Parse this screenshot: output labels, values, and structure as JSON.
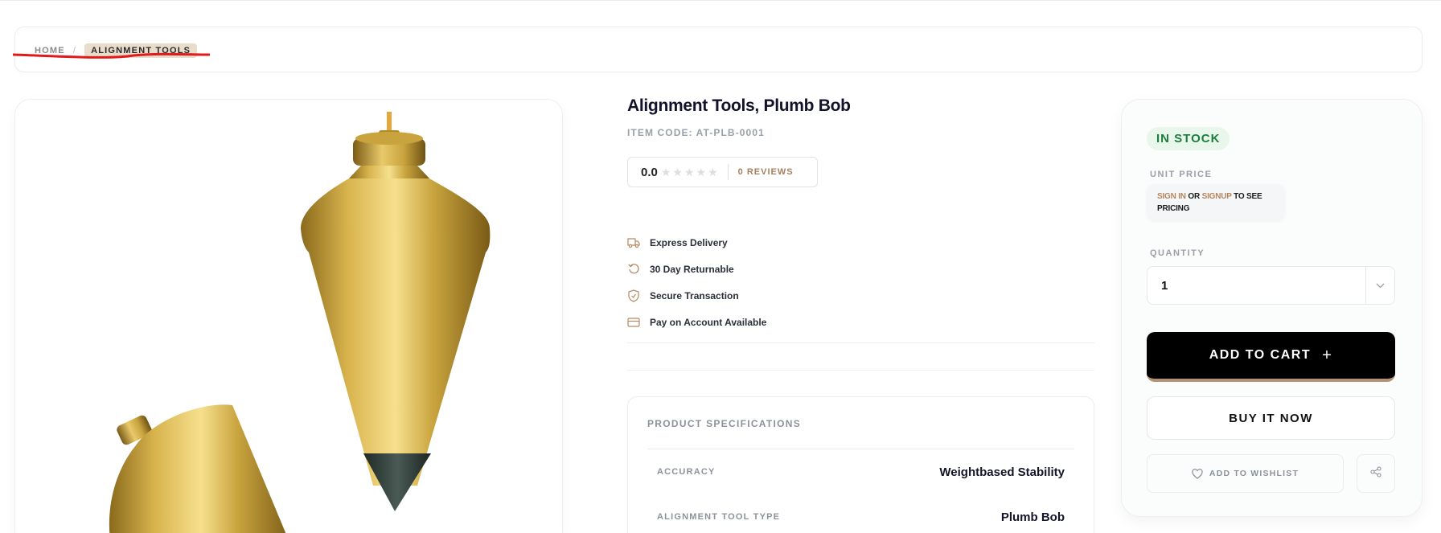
{
  "breadcrumb": {
    "home": "HOME",
    "separator": "/",
    "current": "ALIGNMENT TOOLS"
  },
  "product": {
    "title": "Alignment Tools, Plumb Bob",
    "item_code": "ITEM CODE: AT-PLB-0001",
    "rating_value": "0.0",
    "stars_filled": 0,
    "stars_total": 5,
    "reviews": "0 REVIEWS",
    "image_icon": "plumb-bob-photo"
  },
  "features": [
    {
      "icon": "truck-icon",
      "label": "Express Delivery"
    },
    {
      "icon": "return-icon",
      "label": "30 Day Returnable"
    },
    {
      "icon": "shield-check-icon",
      "label": "Secure Transaction"
    },
    {
      "icon": "credit-card-icon",
      "label": "Pay on Account Available"
    }
  ],
  "specs": {
    "title": "PRODUCT SPECIFICATIONS",
    "rows": [
      {
        "key": "ACCURACY",
        "value": "Weightbased Stability"
      },
      {
        "key": "ALIGNMENT TOOL TYPE",
        "value": "Plumb Bob"
      }
    ]
  },
  "buy_box": {
    "stock": "IN STOCK",
    "unit_price_label": "UNIT PRICE",
    "sign_in": "SIGN IN",
    "or": " OR ",
    "signup": "SIGNUP",
    "price_suffix": " TO SEE PRICING",
    "quantity_label": "QUANTITY",
    "quantity_value": "1",
    "add_to_cart": "ADD TO CART",
    "add_icon": "+",
    "buy_now": "BUY IT NOW",
    "wishlist": "ADD TO WISHLIST"
  },
  "colors": {
    "accent": "#b39272",
    "stock_green": "#1b7f3a",
    "brass": "#c9a43e",
    "annotation_red": "#e01b1b"
  }
}
